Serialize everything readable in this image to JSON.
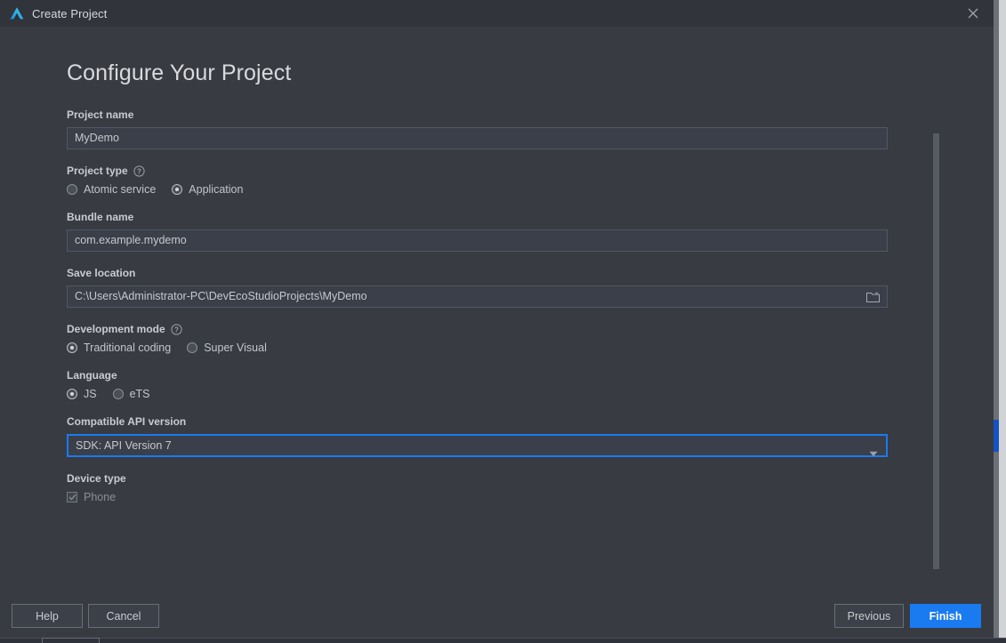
{
  "window": {
    "title": "Create Project",
    "logo_icon": "deveco-triangle-logo",
    "close_icon": "close-icon"
  },
  "page": {
    "heading": "Configure Your Project"
  },
  "fields": {
    "project_name": {
      "label": "Project name",
      "value": "MyDemo",
      "placeholder": "Project name"
    },
    "project_type": {
      "label": "Project type",
      "help_icon": "help-circle-icon",
      "options": [
        {
          "label": "Atomic service",
          "checked": false
        },
        {
          "label": "Application",
          "checked": true
        }
      ]
    },
    "bundle_name": {
      "label": "Bundle name",
      "value": "com.example.mydemo",
      "placeholder": "Bundle name"
    },
    "save_location": {
      "label": "Save location",
      "value": "C:\\Users\\Administrator-PC\\DevEcoStudioProjects\\MyDemo",
      "placeholder": "Save location",
      "browse_icon": "folder-icon"
    },
    "development_mode": {
      "label": "Development mode",
      "help_icon": "help-circle-icon",
      "options": [
        {
          "label": "Traditional coding",
          "checked": true
        },
        {
          "label": "Super Visual",
          "checked": false
        }
      ]
    },
    "language": {
      "label": "Language",
      "options": [
        {
          "label": "JS",
          "checked": true
        },
        {
          "label": "eTS",
          "checked": false
        }
      ]
    },
    "compatible_api_version": {
      "label": "Compatible API version",
      "value": "SDK: API Version 7",
      "arrow_icon": "chevron-down-icon",
      "options": [
        "SDK: API Version 7"
      ]
    },
    "device_type": {
      "label": "Device type",
      "options": [
        {
          "label": "Phone",
          "checked": true,
          "disabled": true
        }
      ]
    }
  },
  "footer": {
    "help_label": "Help",
    "cancel_label": "Cancel",
    "previous_label": "Previous",
    "finish_label": "Finish"
  },
  "colors": {
    "accent": "#1a7af0",
    "dialog_bg": "#383b42",
    "titlebar_bg": "#31343b",
    "input_bg": "#3b3f49",
    "text": "#c6c8cd"
  }
}
